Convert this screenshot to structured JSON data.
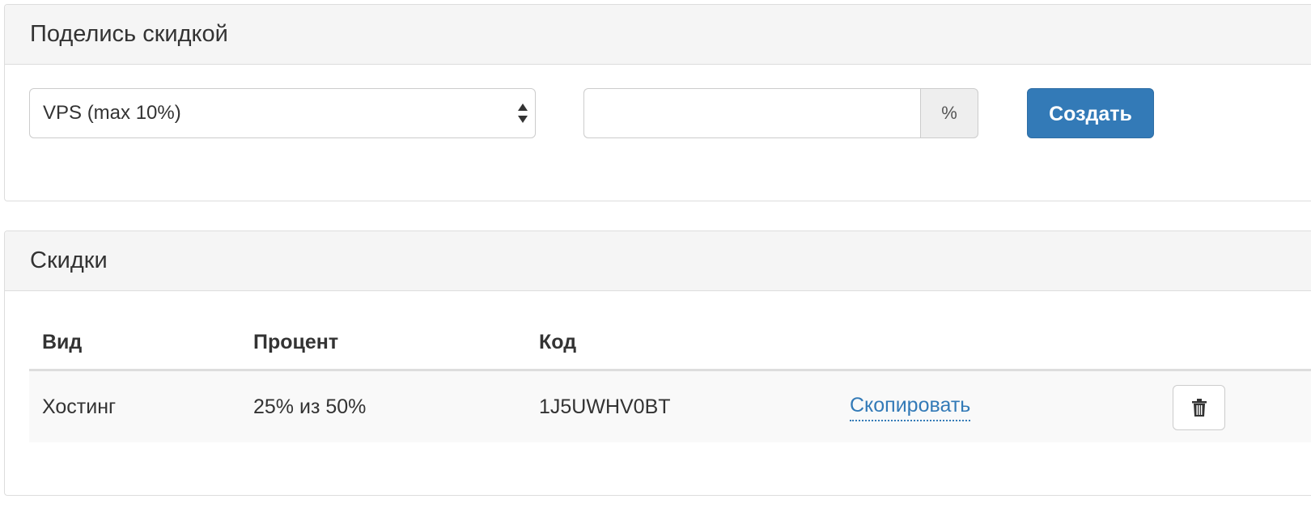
{
  "share_panel": {
    "title": "Поделись скидкой",
    "select": {
      "selected": "VPS (max 10%)"
    },
    "percent_input": {
      "value": "",
      "addon": "%"
    },
    "create_button": "Создать"
  },
  "discounts_panel": {
    "title": "Скидки",
    "columns": [
      "Вид",
      "Процент",
      "Код"
    ],
    "rows": [
      {
        "type": "Хостинг",
        "percent": "25% из 50%",
        "code": "1J5UWHV0BT",
        "copy_label": "Скопировать",
        "delete_icon": "trash-icon"
      }
    ]
  },
  "colors": {
    "primary": "#337ab7",
    "panel_heading_bg": "#f5f5f5",
    "border": "#dddddd",
    "row_stripe": "#f9f9f9"
  }
}
